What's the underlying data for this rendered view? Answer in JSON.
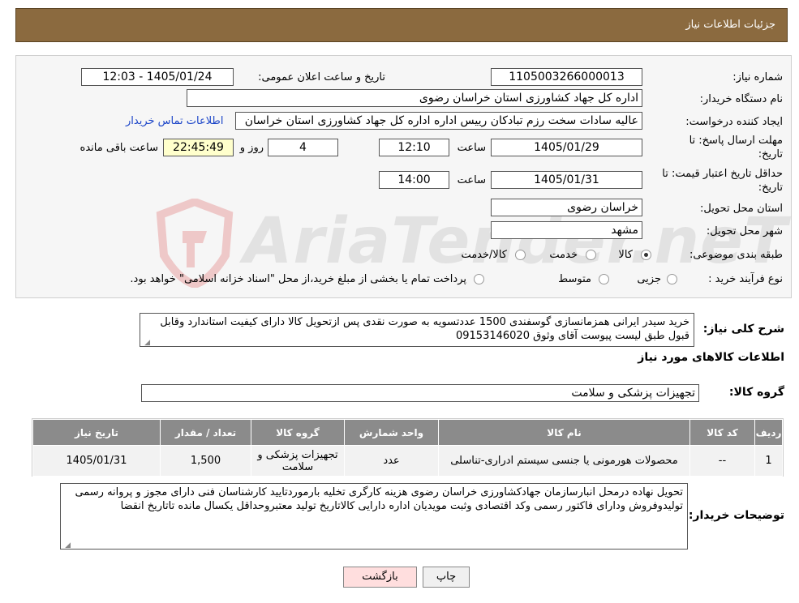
{
  "header": {
    "title": "جزئیات اطلاعات نیاز"
  },
  "labels": {
    "need_number": "شماره نیاز:",
    "announce_datetime": "تاریخ و ساعت اعلان عمومی:",
    "buyer_org": "نام دستگاه خریدار:",
    "requester": "ایجاد کننده درخواست:",
    "deadline_line1": "مهلت ارسال پاسخ: تا",
    "deadline_line2": "تاریخ:",
    "hour": "ساعت",
    "day_and": "روز و",
    "time_remaining": "ساعت باقی مانده",
    "validity_line1": "حداقل تاریخ اعتبار قیمت: تا",
    "validity_line2": "تاریخ:",
    "province": "استان محل تحویل:",
    "city": "شهر محل تحویل:",
    "category": "طبقه بندی موضوعی:",
    "process_type": "نوع فرآیند خرید :",
    "description": "شرح کلی نیاز:",
    "goods_info": "اطلاعات کالاهای مورد نیاز",
    "goods_group": "گروه کالا:",
    "buyer_notes": "توضیحات خریدار:"
  },
  "values": {
    "need_number": "1105003266000013",
    "announce_datetime": "1405/01/24 - 12:03",
    "buyer_org": "اداره کل جهاد کشاورزی استان خراسان رضوی",
    "requester": "عالیه سادات سخت رزم تبادکان رییس اداره  اداره کل جهاد کشاورزی استان خراسان",
    "contact_link": "اطلاعات تماس خریدار",
    "deadline_date": "1405/01/29",
    "deadline_time": "12:10",
    "days_left": "4",
    "time_left": "22:45:49",
    "validity_date": "1405/01/31",
    "validity_time": "14:00",
    "province": "خراسان رضوی",
    "city": "مشهد",
    "goods_group": "تجهیزات پزشکی و سلامت"
  },
  "category_options": {
    "opt1": "کالا",
    "opt2": "خدمت",
    "opt3": "کالا/خدمت",
    "selected": "کالا"
  },
  "process_options": {
    "opt1": "جزیی",
    "opt2": "متوسط",
    "note": "پرداخت تمام یا بخشی از مبلغ خرید،از محل \"اسناد خزانه اسلامی\" خواهد بود."
  },
  "description_text": "خرید سیدر ایرانی همزمانسازی گوسفندی 1500 عددتسویه به صورت نقدی پس ازتحویل کالا دارای کیفیت استاندارد وقابل قبول طبق لیست پیوست آقای وثوق 09153146020",
  "watermark": "AriaTender.neT",
  "table": {
    "headers": [
      "ردیف",
      "کد کالا",
      "نام کالا",
      "واحد شمارش",
      "گروه کالا",
      "تعداد / مقدار",
      "تاریخ نیاز"
    ],
    "rows": [
      [
        "1",
        "--",
        "محصولات هورمونی یا جنسی سیستم ادراری-تناسلی",
        "عدد",
        "تجهیزات پزشکی و سلامت",
        "1,500",
        "1405/01/31"
      ]
    ]
  },
  "buyer_notes_text": "تحویل نهاده درمحل انبارسازمان جهادکشاورزی خراسان رضوی هزینه کارگری تخلیه بارموردتایید کارشناسان فنی  دارای مجوز و پروانه رسمی تولیدوفروش ودارای فاکتور رسمی وکد اقتصادی وثبت مویدیان اداره دارایی کالاتاریخ تولید معتبروحداقل یکسال مانده تاتاریخ انقضا",
  "buttons": {
    "print": "چاپ",
    "back": "بازگشت"
  }
}
